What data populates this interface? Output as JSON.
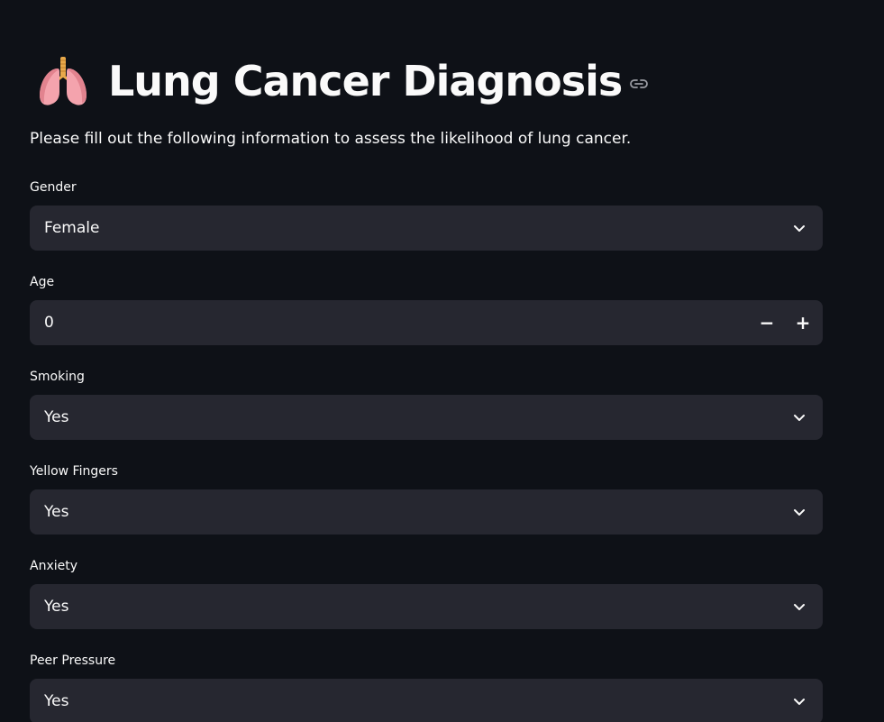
{
  "header": {
    "icon": "lungs-icon",
    "title": "Lung Cancer Diagnosis",
    "link_icon": "link-icon"
  },
  "intro": "Please fill out the following information to assess the likelihood of lung cancer.",
  "form": {
    "gender": {
      "label": "Gender",
      "value": "Female"
    },
    "age": {
      "label": "Age",
      "value": "0",
      "minus": "−",
      "plus": "+"
    },
    "smoking": {
      "label": "Smoking",
      "value": "Yes"
    },
    "yellow_fingers": {
      "label": "Yellow Fingers",
      "value": "Yes"
    },
    "anxiety": {
      "label": "Anxiety",
      "value": "Yes"
    },
    "peer_pressure": {
      "label": "Peer Pressure",
      "value": "Yes"
    }
  },
  "colors": {
    "background": "#0e1117",
    "input_background": "#262730",
    "text": "#fafafa"
  }
}
